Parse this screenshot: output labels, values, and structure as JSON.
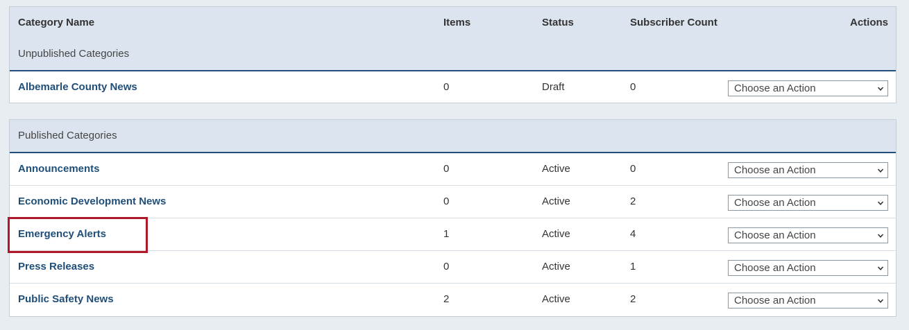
{
  "columns": {
    "category_name": "Category Name",
    "items": "Items",
    "status": "Status",
    "subscriber_count": "Subscriber Count",
    "actions": "Actions"
  },
  "unpublished": {
    "heading": "Unpublished Categories",
    "rows": [
      {
        "name": "Albemarle County News",
        "items": "0",
        "status": "Draft",
        "subscribers": "0",
        "action": "Choose an Action"
      }
    ]
  },
  "published": {
    "heading": "Published Categories",
    "rows": [
      {
        "name": "Announcements",
        "items": "0",
        "status": "Active",
        "subscribers": "0",
        "action": "Choose an Action"
      },
      {
        "name": "Economic Development News",
        "items": "0",
        "status": "Active",
        "subscribers": "2",
        "action": "Choose an Action"
      },
      {
        "name": "Emergency Alerts",
        "items": "1",
        "status": "Active",
        "subscribers": "4",
        "action": "Choose an Action"
      },
      {
        "name": "Press Releases",
        "items": "0",
        "status": "Active",
        "subscribers": "1",
        "action": "Choose an Action"
      },
      {
        "name": "Public Safety News",
        "items": "2",
        "status": "Active",
        "subscribers": "2",
        "action": "Choose an Action"
      }
    ]
  },
  "highlighted_row": "Emergency Alerts",
  "colors": {
    "link": "#1f4e79",
    "header_bg": "#dce5ef",
    "highlight": "#b0182a",
    "page_bg": "#e8edf2"
  }
}
